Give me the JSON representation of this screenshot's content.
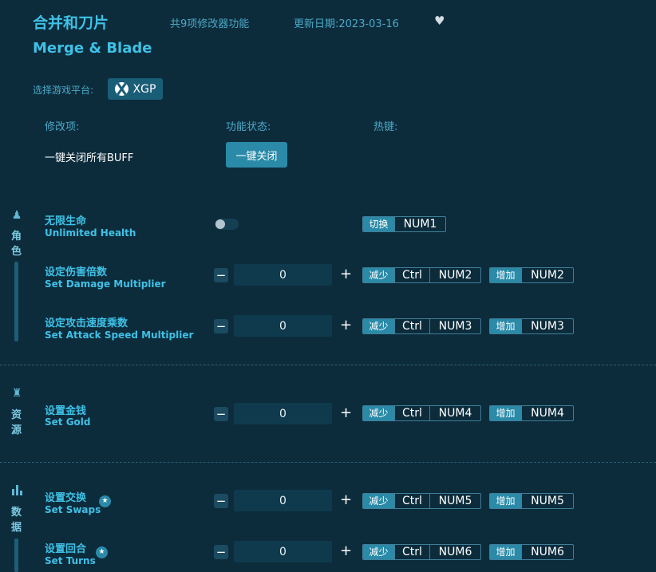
{
  "header": {
    "title_cn": "合并和刀片",
    "title_en": "Merge & Blade",
    "feature_count": "共9项修改器功能",
    "update_date": "更新日期:2023-03-16"
  },
  "platform": {
    "label": "选择游戏平台:",
    "selected": "XGP"
  },
  "columns": {
    "option": "修改项:",
    "status": "功能状态:",
    "hotkey": "热键:"
  },
  "disable_all": {
    "label": "一键关闭所有BUFF",
    "button": "一键关闭"
  },
  "categories": [
    {
      "chars": [
        "角",
        "色"
      ]
    },
    {
      "chars": [
        "资",
        "源"
      ]
    },
    {
      "chars": [
        "数",
        "据"
      ]
    }
  ],
  "options": [
    {
      "cn": "无限生命",
      "en": "Unlimited Health",
      "type": "toggle",
      "on": false,
      "hotkeys": [
        {
          "label": "切换",
          "keys": [
            "NUM1"
          ]
        }
      ]
    },
    {
      "cn": "设定伤害倍数",
      "en": "Set Damage Multiplier",
      "type": "stepper",
      "value": "0",
      "hotkeys": [
        {
          "label": "减少",
          "keys": [
            "Ctrl",
            "NUM2"
          ]
        },
        {
          "label": "增加",
          "keys": [
            "NUM2"
          ]
        }
      ]
    },
    {
      "cn": "设定攻击速度乘数",
      "en": "Set Attack Speed Multiplier",
      "type": "stepper",
      "value": "0",
      "hotkeys": [
        {
          "label": "减少",
          "keys": [
            "Ctrl",
            "NUM3"
          ]
        },
        {
          "label": "增加",
          "keys": [
            "NUM3"
          ]
        }
      ]
    },
    {
      "cn": "设置金钱",
      "en": "Set Gold",
      "type": "stepper",
      "value": "0",
      "hotkeys": [
        {
          "label": "减少",
          "keys": [
            "Ctrl",
            "NUM4"
          ]
        },
        {
          "label": "增加",
          "keys": [
            "NUM4"
          ]
        }
      ]
    },
    {
      "cn": "设置交换",
      "en": "Set Swaps",
      "type": "stepper",
      "value": "0",
      "starred": true,
      "hotkeys": [
        {
          "label": "减少",
          "keys": [
            "Ctrl",
            "NUM5"
          ]
        },
        {
          "label": "增加",
          "keys": [
            "NUM5"
          ]
        }
      ]
    },
    {
      "cn": "设置回合",
      "en": "Set Turns",
      "type": "stepper",
      "value": "0",
      "starred": true,
      "hotkeys": [
        {
          "label": "减少",
          "keys": [
            "Ctrl",
            "NUM6"
          ]
        },
        {
          "label": "增加",
          "keys": [
            "NUM6"
          ]
        }
      ]
    }
  ],
  "stepper": {
    "minus": "−",
    "plus": "+"
  },
  "colors": {
    "background": "#0c2c3c",
    "accent": "#3fc1e6",
    "button": "#2a8aa8"
  }
}
